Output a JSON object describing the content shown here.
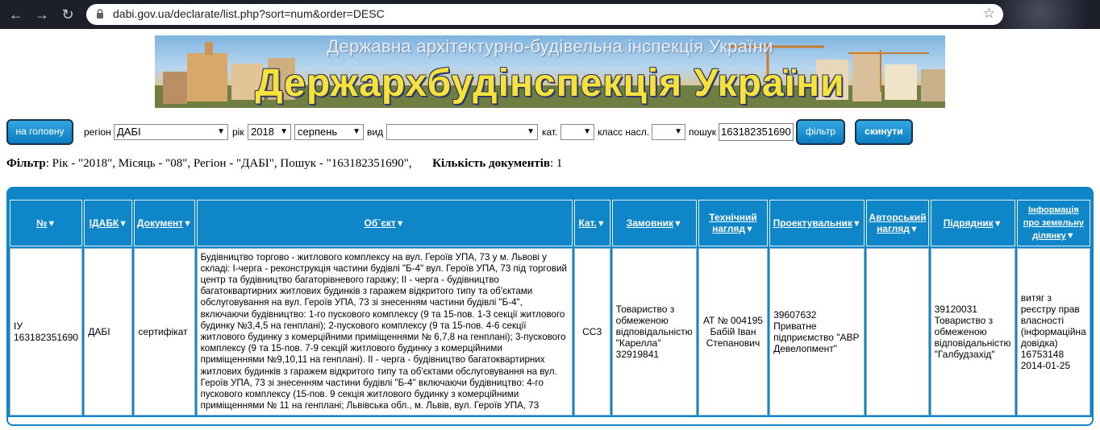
{
  "browser": {
    "url": "dabi.gov.ua/declarate/list.php?sort=num&order=DESC"
  },
  "banner": {
    "subtitle": "Державна архітектурно-будівельна інспекція України",
    "title": "Держархбудінспекція України"
  },
  "filters": {
    "home_label": "на головну",
    "region_label": "регіон",
    "region_value": "ДАБІ",
    "year_label": "рік",
    "year_value": "2018",
    "month_value": "серпень",
    "kind_label": "вид",
    "kind_value": "",
    "category_label": "кат.",
    "category_value": "",
    "class_label": "класс насл.",
    "class_value": "",
    "search_label": "пошук",
    "search_value": "163182351690",
    "filter_button": "фільтр",
    "reset_button": "скинути"
  },
  "summary": {
    "filter_label": "Фільтр",
    "filter_text": ": Рік - \"2018\", Місяць - \"08\", Регіон - \"ДАБІ\", Пошук - \"163182351690\",",
    "count_label": "Кількість документів",
    "count_text": ": 1"
  },
  "table": {
    "columns": [
      {
        "line1": "№",
        "line2": ""
      },
      {
        "line1": "ІДАБК",
        "line2": ""
      },
      {
        "line1": "Документ",
        "line2": ""
      },
      {
        "line1": "Об`єкт",
        "line2": ""
      },
      {
        "line1": "Кат.",
        "line2": ""
      },
      {
        "line1": "Замовник",
        "line2": ""
      },
      {
        "line1": "Технічний",
        "line2": "нагляд"
      },
      {
        "line1": "Проектувальник",
        "line2": ""
      },
      {
        "line1": "Авторський",
        "line2": "нагляд"
      },
      {
        "line1": "Підрядник",
        "line2": ""
      },
      {
        "line1": "Інформація",
        "line2": "про земельну",
        "line3": "ділянку"
      }
    ],
    "sort_glyph": "▼",
    "rows": [
      {
        "num_line1": "ІУ",
        "num_line2": "163182351690",
        "idabk": "ДАБІ",
        "document": "сертифікат",
        "object": "Будівництво торгово - житлового комплексу на вул. Героїв УПА, 73 у м. Львові у складі: І-черга - реконструкція частини будівлі \"Б-4\" вул. Героїв УПА, 73 під торговий центр та будівництво багаторівневого гаражу; ІІ - черга - будівництво багатоквартирних житлових будинків з гаражем відкритого типу та об'єктами обслуговування на вул. Героїв УПА, 73 зі знесенням частини будівлі \"Б-4\", включаючи будівництво: 1-го пускового комплексу (9 та 15-пов. 1-3 секції житлового будинку №3,4,5 на генплані); 2-пускового комплексу (9 та 15-пов. 4-6 секції житлового будинку з комерційними приміщеннями № 6,7,8 на генплані); 3-пускового комплексу (9 та 15-пов. 7-9 секцій житлового будинку з комерційними приміщеннями №9,10,11 на генплані). ІІ - черга - будівництво багатоквартирних житлових будинків з гаражем відкритого типу та об'єктами обслуговування на вул. Героїв УПА, 73 зі знесенням частини будівлі \"Б-4\" включаючи будівництво: 4-го пускового комплексу (15-пов. 9 секція житлового будинку з комерційними приміщеннями № 11 на генплані; Львівська обл., м. Львів, вул. Героїв УПА, 73",
        "category": "СС3",
        "customer": "Товариство з обмеженою відповідальністю \"Карелла\" 32919841",
        "tech_supervision": "АТ № 004195 Бабій Іван Степанович",
        "designer": "39607632 Приватне підприємство \"АВР Девелопмент\"",
        "author_supervision": "",
        "contractor": "39120031 Товариство з обмеженою відповідальністю \"Галбудзахід\"",
        "land_info": "витяг з реєстру прав власності (інформаційна довідка) 16753148 2014-01-25"
      }
    ]
  },
  "colors": {
    "accent": "#0e86c8",
    "button": "#1a8fd0",
    "banner_title": "#f6e23a"
  }
}
